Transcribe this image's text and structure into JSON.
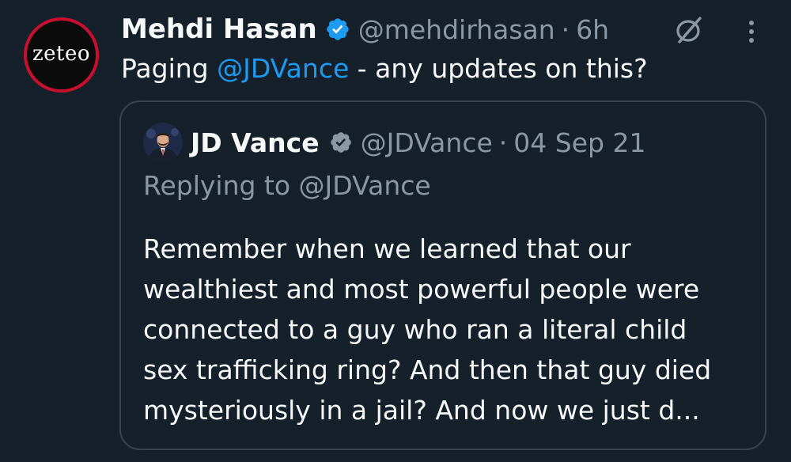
{
  "tweet": {
    "avatar": {
      "text": "zeteo"
    },
    "author": {
      "name": "Mehdi Hasan",
      "handle": "@mehdirhasan",
      "separator": "·",
      "time": "6h"
    },
    "text": {
      "prefix": "Paging ",
      "mention": "@JDVance",
      "suffix": " - any updates on this?"
    },
    "icons": {
      "grok": "grok-icon",
      "more": "more-vertical-icon",
      "verified": "verified-badge-icon"
    }
  },
  "quote": {
    "author": {
      "name": "JD Vance",
      "handle": "@JDVance",
      "separator": "·",
      "date": "04 Sep 21"
    },
    "replying_to": "Replying to @JDVance",
    "body_lines": [
      "Remember when we learned that our",
      "wealthiest and most powerful people were",
      "connected to a guy who ran a literal child",
      "sex trafficking ring? And then that guy died",
      "mysteriously in a jail? And now we just d..."
    ]
  },
  "colors": {
    "background": "#15202b",
    "primary_text": "#f7f9f9",
    "secondary_text": "#8b98a5",
    "link": "#1d9bf0",
    "card_border": "#38444d",
    "verified_badge": "#1d9bf0",
    "avatar_ring": "#c8102e"
  }
}
